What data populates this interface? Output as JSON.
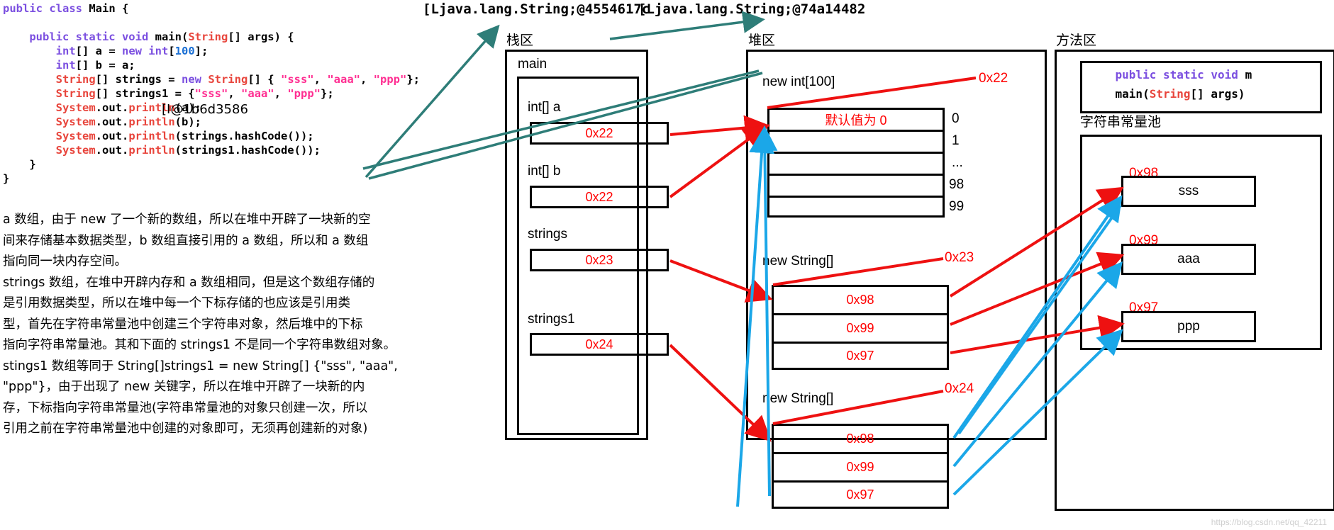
{
  "code": {
    "lines": [
      [
        {
          "t": "public class ",
          "c": "kw"
        },
        {
          "t": "Main",
          "c": "pl"
        },
        {
          "t": " {",
          "c": "pl"
        }
      ],
      [],
      [
        {
          "t": "    public static void ",
          "c": "kw"
        },
        {
          "t": "main",
          "c": "pl"
        },
        {
          "t": "(",
          "c": "pl"
        },
        {
          "t": "String",
          "c": "ty"
        },
        {
          "t": "[] args) {",
          "c": "pl"
        }
      ],
      [
        {
          "t": "        int",
          "c": "kw"
        },
        {
          "t": "[] a = ",
          "c": "pl"
        },
        {
          "t": "new int",
          "c": "kw"
        },
        {
          "t": "[",
          "c": "pl"
        },
        {
          "t": "100",
          "c": "num"
        },
        {
          "t": "];",
          "c": "pl"
        }
      ],
      [
        {
          "t": "        int",
          "c": "kw"
        },
        {
          "t": "[] b = a;",
          "c": "pl"
        }
      ],
      [
        {
          "t": "        String",
          "c": "ty"
        },
        {
          "t": "[] strings = ",
          "c": "pl"
        },
        {
          "t": "new ",
          "c": "kw"
        },
        {
          "t": "String",
          "c": "ty"
        },
        {
          "t": "[] { ",
          "c": "pl"
        },
        {
          "t": "\"sss\"",
          "c": "str"
        },
        {
          "t": ", ",
          "c": "pl"
        },
        {
          "t": "\"aaa\"",
          "c": "str"
        },
        {
          "t": ", ",
          "c": "pl"
        },
        {
          "t": "\"ppp\"",
          "c": "str"
        },
        {
          "t": "};",
          "c": "pl"
        }
      ],
      [
        {
          "t": "        String",
          "c": "ty"
        },
        {
          "t": "[] strings1 = {",
          "c": "pl"
        },
        {
          "t": "\"sss\"",
          "c": "str"
        },
        {
          "t": ", ",
          "c": "pl"
        },
        {
          "t": "\"aaa\"",
          "c": "str"
        },
        {
          "t": ", ",
          "c": "pl"
        },
        {
          "t": "\"ppp\"",
          "c": "str"
        },
        {
          "t": "};",
          "c": "pl"
        }
      ],
      [
        {
          "t": "        System",
          "c": "ty"
        },
        {
          "t": ".out.",
          "c": "pl"
        },
        {
          "t": "println",
          "c": "ty"
        },
        {
          "t": "(a);",
          "c": "pl"
        }
      ],
      [
        {
          "t": "        System",
          "c": "ty"
        },
        {
          "t": ".out.",
          "c": "pl"
        },
        {
          "t": "println",
          "c": "ty"
        },
        {
          "t": "(b);",
          "c": "pl"
        }
      ],
      [
        {
          "t": "        System",
          "c": "ty"
        },
        {
          "t": ".out.",
          "c": "pl"
        },
        {
          "t": "println",
          "c": "ty"
        },
        {
          "t": "(strings.hashCode());",
          "c": "pl"
        }
      ],
      [
        {
          "t": "        System",
          "c": "ty"
        },
        {
          "t": ".out.",
          "c": "pl"
        },
        {
          "t": "println",
          "c": "ty"
        },
        {
          "t": "(strings1.hashCode());",
          "c": "pl"
        }
      ],
      [
        {
          "t": "    }",
          "c": "pl"
        }
      ],
      [
        {
          "t": "}",
          "c": "pl"
        }
      ]
    ],
    "console_output_int_array": "[I@1b6d3586"
  },
  "top_labels": {
    "strings_hash": "[Ljava.lang.String;@4554617c",
    "strings1_hash": "[Ljava.lang.String;@74a14482"
  },
  "prose": [
    "a 数组，由于 new 了一个新的数组，所以在堆中开辟了一块新的空",
    "间来存储基本数据类型，b 数组直接引用的 a 数组，所以和 a 数组",
    "指向同一块内存空间。",
    "strings 数组，在堆中开辟内存和 a 数组相同，但是这个数组存储的",
    "是引用数据类型，所以在堆中每一个下标存储的也应该是引用类",
    "型，首先在字符串常量池中创建三个字符串对象，然后堆中的下标",
    "指向字符串常量池。其和下面的 strings1 不是同一个字符串数组对象。",
    "stings1 数组等同于 String[]strings1 = new String[] {\"sss\", \"aaa\",",
    "\"ppp\"}，由于出现了 new 关键字，所以在堆中开辟了一块新的内",
    "存，下标指向字符串常量池(字符串常量池的对象只创建一次，所以",
    "引用之前在字符串常量池中创建的对象即可，无须再创建新的对象)"
  ],
  "stack": {
    "title": "栈区",
    "frame_label": "main",
    "variables": [
      {
        "name": "int[] a",
        "value": "0x22"
      },
      {
        "name": "int[] b",
        "value": "0x22"
      },
      {
        "name": "strings",
        "value": "0x23"
      },
      {
        "name": "strings1",
        "value": "0x24"
      }
    ]
  },
  "heap": {
    "title": "堆区",
    "objects": [
      {
        "label": "new int[100]",
        "address": "0x22",
        "note": "默认值为 0",
        "cells": [
          "默认值为 0",
          "",
          "",
          "",
          ""
        ],
        "indices": [
          "0",
          "1",
          "...",
          "98",
          "99"
        ]
      },
      {
        "label": "new String[]",
        "address": "0x23",
        "cells": [
          "0x98",
          "0x99",
          "0x97"
        ],
        "indices": []
      },
      {
        "label": "new String[]",
        "address": "0x24",
        "cells": [
          "0x98",
          "0x99",
          "0x97"
        ],
        "indices": []
      }
    ]
  },
  "method_area": {
    "title": "方法区",
    "code_lines": [
      [
        {
          "t": "    public static void ",
          "c": "kw"
        },
        {
          "t": "m",
          "c": "pl"
        }
      ],
      [
        {
          "t": "    main(",
          "c": "pl"
        },
        {
          "t": "String",
          "c": "ty"
        },
        {
          "t": "[] args)",
          "c": "pl"
        }
      ]
    ],
    "pool_title": "字符串常量池",
    "pool_entries": [
      {
        "address": "0x98",
        "value": "sss"
      },
      {
        "address": "0x99",
        "value": "aaa"
      },
      {
        "address": "0x97",
        "value": "ppp"
      }
    ]
  },
  "colors": {
    "red_arrow": "#ee1111",
    "cyan_arrow": "#1ba7e8",
    "teal_arrow": "#2e7d78",
    "red_text": "#ff0000",
    "box_border": "#000000"
  },
  "watermark": "https://blog.csdn.net/qq_42211"
}
